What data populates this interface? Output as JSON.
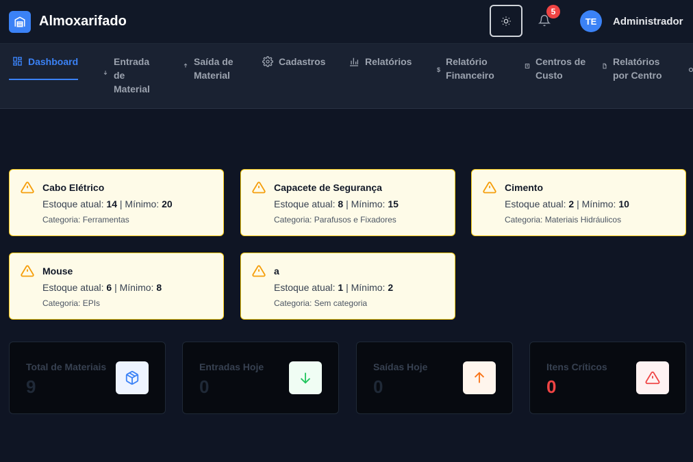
{
  "app": {
    "title": "Almoxarifado"
  },
  "header": {
    "notifications_count": "5",
    "avatar_initials": "TE",
    "user_name": "Administrador"
  },
  "nav": {
    "items": [
      {
        "label": "Dashboard",
        "icon": "grid-icon",
        "active": true
      },
      {
        "label": "Entrada de Material",
        "icon": "arrow-down-icon"
      },
      {
        "label": "Saída de Material",
        "icon": "arrow-up-icon"
      },
      {
        "label": "Cadastros",
        "icon": "gear-icon"
      },
      {
        "label": "Relatórios",
        "icon": "bar-chart-icon"
      },
      {
        "label": "Relatório Financeiro",
        "icon": "dollar-icon"
      },
      {
        "label": "Centros de Custo",
        "icon": "building-icon"
      },
      {
        "label": "Relatórios por Centro",
        "icon": "file-icon"
      }
    ]
  },
  "labels": {
    "stock_current": "Estoque atual:",
    "stock_min": "Mínimo:",
    "category": "Categoria:"
  },
  "alerts": [
    {
      "name": "Cabo Elétrico",
      "current": "14",
      "minimum": "20",
      "category": "Ferramentas"
    },
    {
      "name": "Capacete de Segurança",
      "current": "8",
      "minimum": "15",
      "category": "Parafusos e Fixadores"
    },
    {
      "name": "Cimento",
      "current": "2",
      "minimum": "10",
      "category": "Materiais Hidráulicos"
    },
    {
      "name": "Mouse",
      "current": "6",
      "minimum": "8",
      "category": "EPIs"
    },
    {
      "name": "a",
      "current": "1",
      "minimum": "2",
      "category": "Sem categoria"
    }
  ],
  "stats": [
    {
      "label": "Total de Materiais",
      "value": "9",
      "icon": "box-icon",
      "color": "#3b82f6"
    },
    {
      "label": "Entradas Hoje",
      "value": "0",
      "icon": "arrow-down-icon",
      "color": "#22c55e"
    },
    {
      "label": "Saídas Hoje",
      "value": "0",
      "icon": "arrow-up-icon",
      "color": "#f97316"
    },
    {
      "label": "Itens Críticos",
      "value": "0",
      "icon": "alert-triangle-icon",
      "color": "#ef4444"
    }
  ],
  "colors": {
    "accent": "#3b82f6",
    "warning": "#f59e0b",
    "danger": "#ef4444",
    "success": "#22c55e"
  }
}
